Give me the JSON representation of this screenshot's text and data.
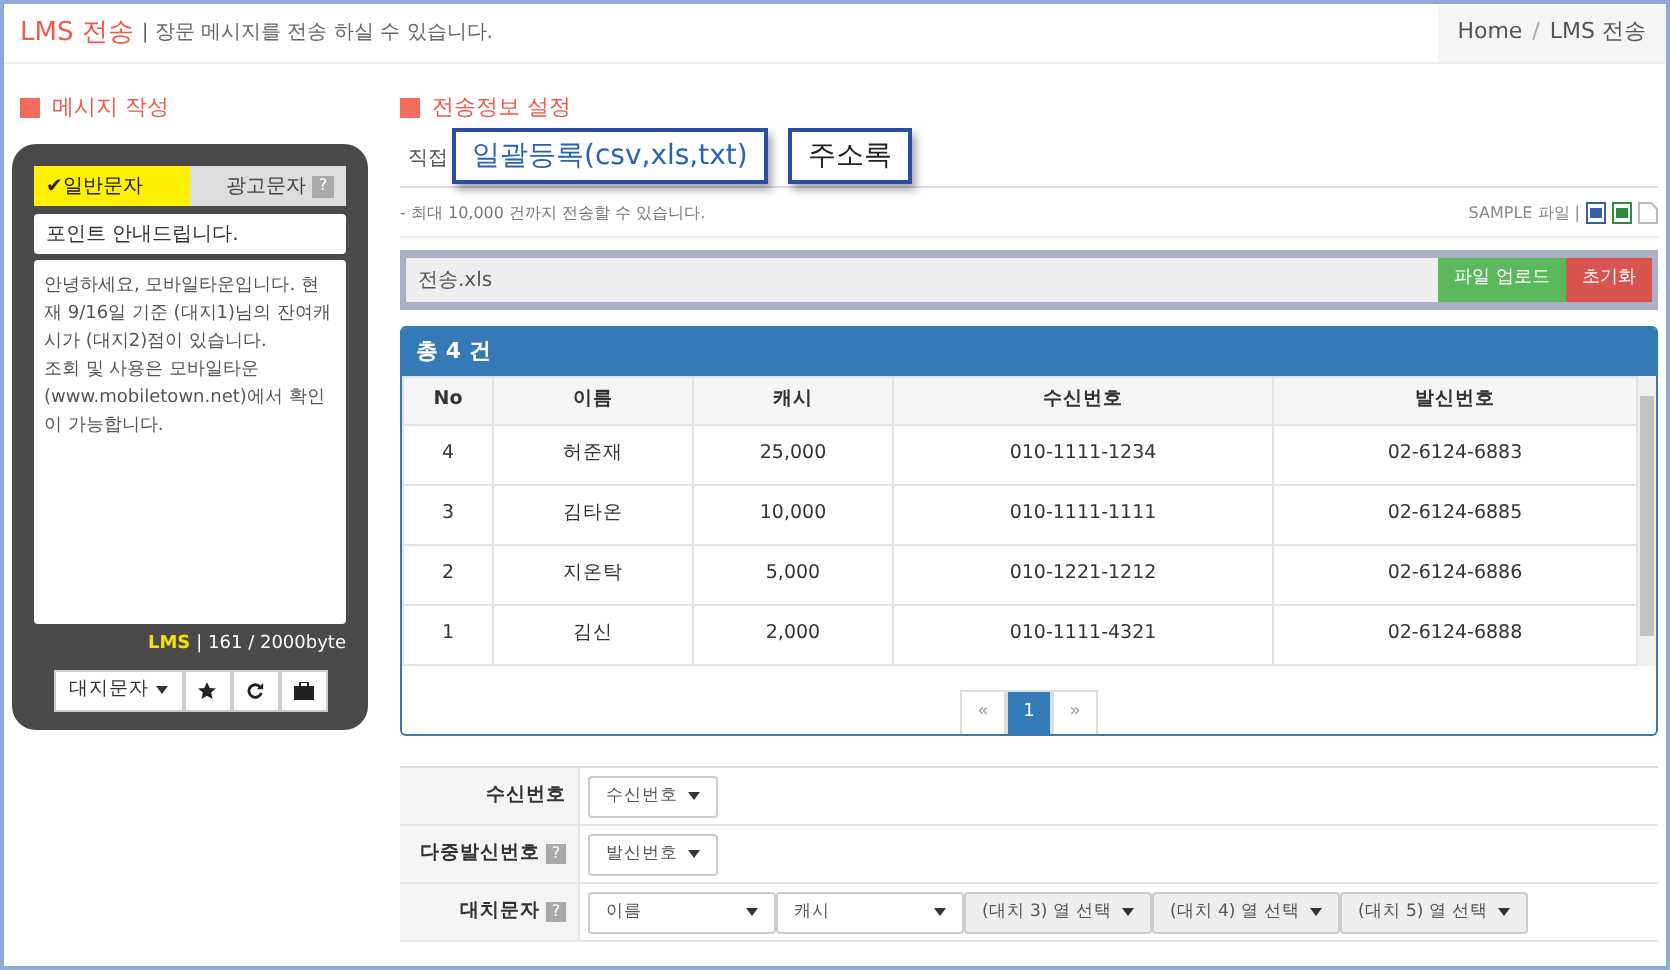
{
  "header": {
    "title": "LMS 전송",
    "subtitle": "| 장문 메시지를 전송 하실 수 있습니다.",
    "breadcrumb": [
      "Home",
      "/",
      "LMS 전송"
    ]
  },
  "composer": {
    "heading": "메시지 작성",
    "tabs": [
      {
        "label": "✔일반문자",
        "selected": true
      },
      {
        "label": "광고문자",
        "selected": false,
        "help": "?"
      }
    ],
    "subject": "포인트 안내드립니다.",
    "message": "안녕하세요, 모바일타운입니다. 현재 9/16일 기준 (대지1)님의 잔여캐시가 (대지2)점이 있습니다.\n조회 및 사용은 모바일타운(www.mobiletown.net)에서 확인이 가능합니다.",
    "counter_type": "LMS",
    "counter": "| 161 / 2000byte",
    "buttons": [
      {
        "kind": "dropdown",
        "label": "대지문자"
      },
      {
        "kind": "star"
      },
      {
        "kind": "refresh"
      },
      {
        "kind": "briefcase"
      }
    ]
  },
  "settings": {
    "heading": "전송정보 설정",
    "tabs": [
      {
        "label": "직접",
        "selected": false
      },
      {
        "label": "일괄등록(csv,xls,txt)",
        "selected": true
      },
      {
        "label": "주소록",
        "selected": false
      }
    ],
    "note": "- 최대 10,000 건까지 전송할 수 있습니다.",
    "sample_label": "SAMPLE 파일 |",
    "sample_files": [
      {
        "kind": "doc"
      },
      {
        "kind": "excel"
      },
      {
        "kind": "text"
      }
    ],
    "file_field": "전송.xls",
    "upload_button": "파일 업로드",
    "reset_button": "초기화",
    "table": {
      "title": "총 4 건",
      "columns": [
        "No",
        "이름",
        "캐시",
        "수신번호",
        "발신번호"
      ],
      "rows": [
        [
          "4",
          "허준재",
          "25,000",
          "010-1111-1234",
          "02-6124-6883"
        ],
        [
          "3",
          "김타온",
          "10,000",
          "010-1111-1111",
          "02-6124-6885"
        ],
        [
          "2",
          "지온탁",
          "5,000",
          "010-1221-1212",
          "02-6124-6886"
        ],
        [
          "1",
          "김신",
          "2,000",
          "010-1111-4321",
          "02-6124-6888"
        ]
      ]
    },
    "pagination": [
      {
        "label": "«",
        "selected": false
      },
      {
        "label": "1",
        "selected": true
      },
      {
        "label": "»",
        "selected": false
      }
    ],
    "form": [
      {
        "label": "수신번호",
        "selects": [
          {
            "value": "수신번호",
            "disabled": false
          }
        ]
      },
      {
        "label": "다중발신번호",
        "help": "?",
        "selects": [
          {
            "value": "발신번호",
            "disabled": false
          }
        ]
      },
      {
        "label": "대치문자",
        "help": "?",
        "selects": [
          {
            "value": "이름",
            "disabled": false
          },
          {
            "value": "캐시",
            "disabled": false
          },
          {
            "value": "(대치 3) 열 선택",
            "disabled": true
          },
          {
            "value": "(대치 4) 열 선택",
            "disabled": true
          },
          {
            "value": "(대치 5) 열 선택",
            "disabled": true
          }
        ]
      }
    ]
  }
}
